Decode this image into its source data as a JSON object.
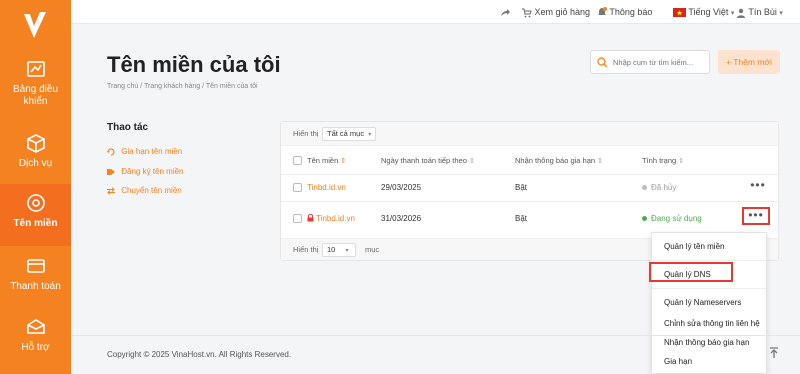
{
  "topbar": {
    "cart_label": "Xem giỏ hàng",
    "notify_label": "Thông báo",
    "language_label": "Tiếng Việt",
    "user_label": "Tín Bùi"
  },
  "sidebar": {
    "items": [
      {
        "label": "Bảng điều khiển",
        "icon": "dashboard-icon"
      },
      {
        "label": "Dịch vụ",
        "icon": "box-icon"
      },
      {
        "label": "Tên miền",
        "icon": "globe-icon"
      },
      {
        "label": "Thanh toán",
        "icon": "card-icon"
      },
      {
        "label": "Hỗ trợ",
        "icon": "support-icon"
      }
    ],
    "active": "Tên miền"
  },
  "header": {
    "title": "Tên miền của tôi",
    "breadcrumb": "Trang chủ  /  Trang khách hàng  /  Tên miền của tôi",
    "search_placeholder": "Nhập cụm từ tìm kiếm...",
    "add_button": "+ Thêm mới"
  },
  "actions": {
    "title": "Thao tác",
    "items": [
      "Gia hạn tên miền",
      "Đăng ký tên miền",
      "Chuyển tên miền"
    ]
  },
  "table": {
    "filter_label": "Hiển thị",
    "filter_value": "Tất cả mục",
    "columns": [
      "Tên miền",
      "Ngày thanh toán tiếp theo",
      "Nhận thông báo gia hạn",
      "Tình trạng"
    ],
    "rows": [
      {
        "domain": "Tinbd.id.vn",
        "next_payment": "29/03/2025",
        "renew_notice": "Bật",
        "status": "Đã hủy",
        "status_color": "#9e9e9e"
      },
      {
        "domain": "Tinbd.id.vn",
        "next_payment": "31/03/2026",
        "renew_notice": "Bật",
        "status": "Đang sử dụng",
        "status_color": "#4caf50"
      }
    ],
    "more_glyph": "•••",
    "footer_label": "Hiển thị",
    "page_size": "10",
    "footer_suffix": "mục"
  },
  "menu": {
    "items": [
      "Quản lý tên miền",
      "Quản lý DNS",
      "Quản lý Nameservers",
      "Chỉnh sửa thông tin liên hệ",
      "Nhận thông báo gia hạn",
      "Gia hạn"
    ]
  },
  "footer": {
    "copyright": "Copyright © 2025 VinaHost.vn. All Rights Reserved."
  },
  "colors": {
    "brand": "#f58220",
    "highlight": "#e53935"
  }
}
